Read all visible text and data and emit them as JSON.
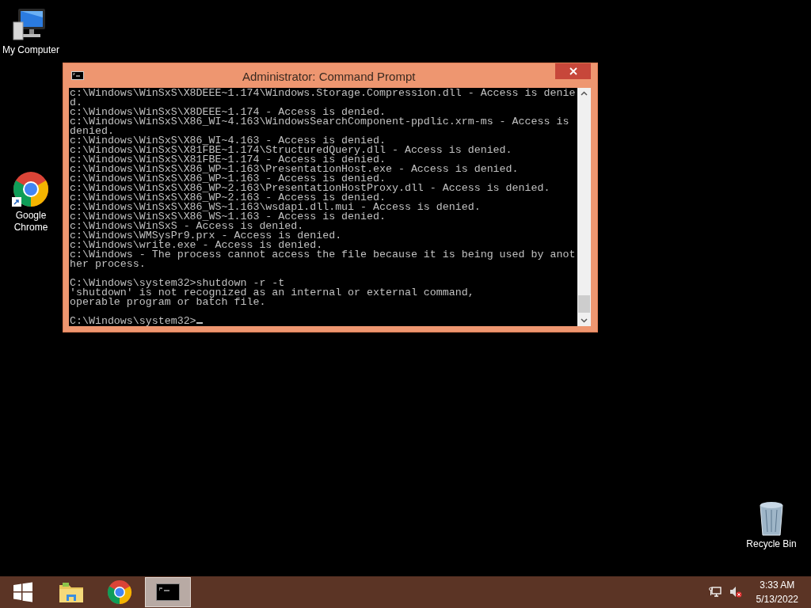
{
  "desktop_icons": [
    {
      "kind": "computer",
      "label": "My Computer"
    },
    {
      "kind": "chrome",
      "label": "Google Chrome"
    },
    {
      "kind": "recycle",
      "label": "Recycle Bin"
    }
  ],
  "window": {
    "title": "Administrator: Command Prompt",
    "console": {
      "log": [
        "c:\\Windows\\WinSxS\\X8DEEE~1.174\\Windows.Storage.Compression.dll - Access is denie",
        "d.",
        "c:\\Windows\\WinSxS\\X8DEEE~1.174 - Access is denied.",
        "c:\\Windows\\WinSxS\\X86_WI~4.163\\WindowsSearchComponent-ppdlic.xrm-ms - Access is",
        "denied.",
        "c:\\Windows\\WinSxS\\X86_WI~4.163 - Access is denied.",
        "c:\\Windows\\WinSxS\\X81FBE~1.174\\StructuredQuery.dll - Access is denied.",
        "c:\\Windows\\WinSxS\\X81FBE~1.174 - Access is denied.",
        "c:\\Windows\\WinSxS\\X86_WP~1.163\\PresentationHost.exe - Access is denied.",
        "c:\\Windows\\WinSxS\\X86_WP~1.163 - Access is denied.",
        "c:\\Windows\\WinSxS\\X86_WP~2.163\\PresentationHostProxy.dll - Access is denied.",
        "c:\\Windows\\WinSxS\\X86_WP~2.163 - Access is denied.",
        "c:\\Windows\\WinSxS\\X86_WS~1.163\\wsdapi.dll.mui - Access is denied.",
        "c:\\Windows\\WinSxS\\X86_WS~1.163 - Access is denied.",
        "c:\\Windows\\WinSxS - Access is denied.",
        "c:\\Windows\\WMSysPr9.prx - Access is denied.",
        "c:\\Windows\\write.exe - Access is denied.",
        "c:\\Windows - The process cannot access the file because it is being used by anot",
        "her process."
      ],
      "command_line": "C:\\Windows\\system32>shutdown -r -t",
      "error": [
        "'shutdown' is not recognized as an internal or external command,",
        "operable program or batch file."
      ],
      "current_prompt": "C:\\Windows\\system32>"
    }
  },
  "taskbar": {
    "apps": [
      {
        "kind": "start",
        "selected": false
      },
      {
        "kind": "explorer",
        "selected": false
      },
      {
        "kind": "chrome",
        "selected": false
      },
      {
        "kind": "cmd",
        "selected": true
      }
    ],
    "time": "3:33 AM",
    "date": "5/13/2022"
  }
}
